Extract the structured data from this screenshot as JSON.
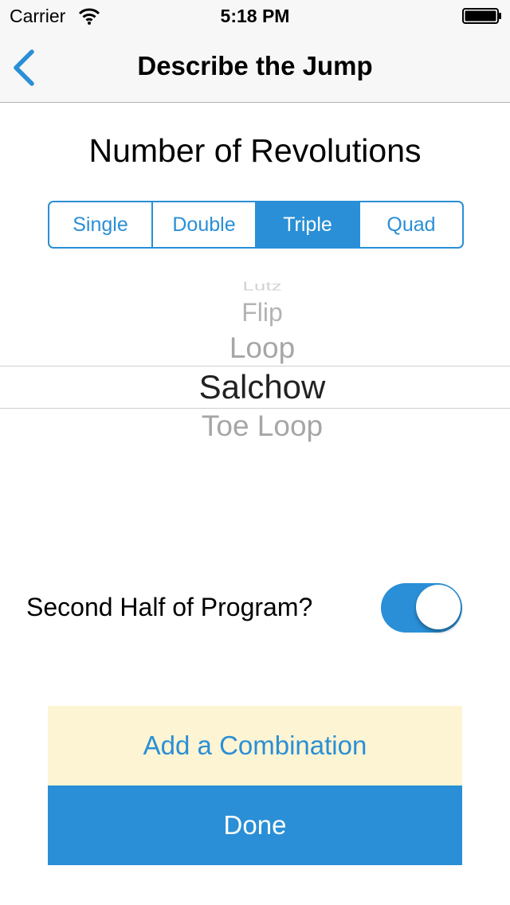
{
  "status_bar": {
    "carrier": "Carrier",
    "time": "5:18 PM"
  },
  "nav": {
    "title": "Describe the Jump",
    "back_icon": "chevron-left-icon"
  },
  "revolutions": {
    "title": "Number of Revolutions",
    "segments": [
      "Single",
      "Double",
      "Triple",
      "Quad"
    ],
    "selected": "Triple"
  },
  "picker": {
    "items": [
      "Lutz",
      "Flip",
      "Loop",
      "Salchow",
      "Toe Loop"
    ],
    "selected": "Salchow"
  },
  "toggle": {
    "label": "Second Half of Program?",
    "on": true
  },
  "buttons": {
    "combination": "Add a Combination",
    "done": "Done"
  },
  "colors": {
    "accent": "#2a8fd6",
    "combination_bg": "#fdf4d3"
  }
}
